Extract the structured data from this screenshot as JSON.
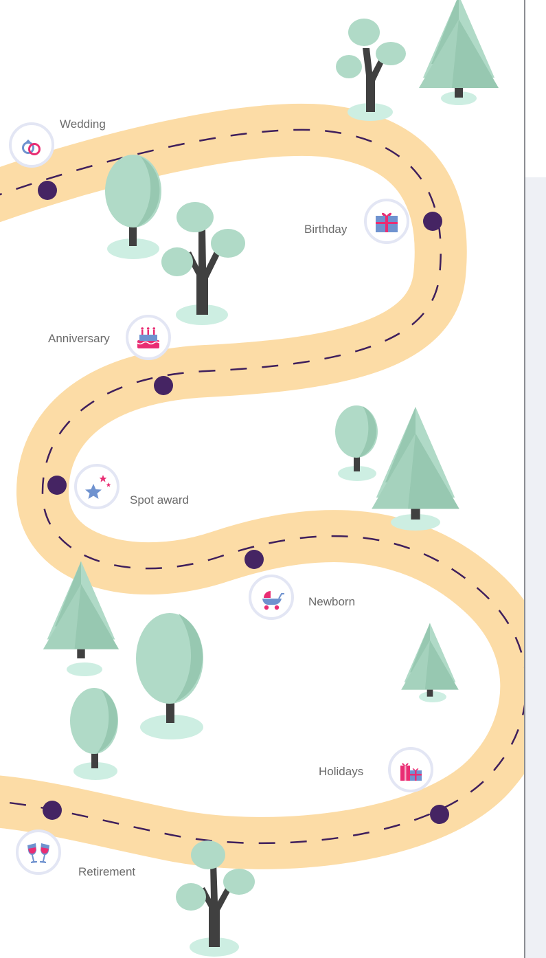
{
  "colors": {
    "road": "#fcdca6",
    "dash": "#3f1f5c",
    "stop": "#452463",
    "tree_light": "#b0dac7",
    "tree_dark": "#97c8b1",
    "trunk": "#404040",
    "ground": "#cdeee2",
    "badge_ring": "#e3e6f4",
    "label": "#6b6b6b",
    "accent_pink": "#e92d73",
    "accent_blue": "#6f92cf"
  },
  "milestones": [
    {
      "key": "wedding",
      "label": "Wedding",
      "icon": "rings-icon"
    },
    {
      "key": "birthday",
      "label": "Birthday",
      "icon": "gift-icon"
    },
    {
      "key": "anniversary",
      "label": "Anniversary",
      "icon": "cake-icon"
    },
    {
      "key": "spot_award",
      "label": "Spot award",
      "icon": "star-icon"
    },
    {
      "key": "newborn",
      "label": "Newborn",
      "icon": "stroller-icon"
    },
    {
      "key": "holidays",
      "label": "Holidays",
      "icon": "gifts-icon"
    },
    {
      "key": "retirement",
      "label": "Retirement",
      "icon": "toast-glasses-icon"
    }
  ]
}
